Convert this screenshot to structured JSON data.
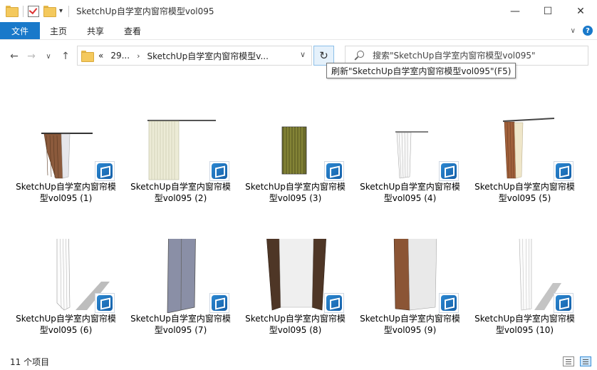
{
  "window": {
    "title": "SketchUp自学室内窗帘模型vol095",
    "minimize": "—",
    "maximize": "☐",
    "close": "✕"
  },
  "ribbon": {
    "file": "文件",
    "tabs": [
      "主页",
      "共享",
      "查看"
    ]
  },
  "nav": {
    "breadcrumb_prefix": "«",
    "breadcrumbs": [
      "29...",
      "SketchUp自学室内窗帘模型v..."
    ],
    "search_placeholder": "搜索\"SketchUp自学室内窗帘模型vol095\"",
    "tooltip": "刷新\"SketchUp自学室内窗帘模型vol095\"(F5)"
  },
  "files": [
    {
      "line1": "SketchUp自学室内窗帘模",
      "line2": "型vol095 (1)"
    },
    {
      "line1": "SketchUp自学室内窗帘模",
      "line2": "型vol095 (2)"
    },
    {
      "line1": "SketchUp自学室内窗帘模",
      "line2": "型vol095 (3)"
    },
    {
      "line1": "SketchUp自学室内窗帘模",
      "line2": "型vol095 (4)"
    },
    {
      "line1": "SketchUp自学室内窗帘模",
      "line2": "型vol095 (5)"
    },
    {
      "line1": "SketchUp自学室内窗帘模",
      "line2": "型vol095 (6)"
    },
    {
      "line1": "SketchUp自学室内窗帘模",
      "line2": "型vol095 (7)"
    },
    {
      "line1": "SketchUp自学室内窗帘模",
      "line2": "型vol095 (8)"
    },
    {
      "line1": "SketchUp自学室内窗帘模",
      "line2": "型vol095 (9)"
    },
    {
      "line1": "SketchUp自学室内窗帘模",
      "line2": "型vol095 (10)"
    }
  ],
  "status": {
    "count": "11 个项目"
  },
  "colors": {
    "accent": "#1979ca",
    "refresh_hover": "#e5f1fb"
  }
}
